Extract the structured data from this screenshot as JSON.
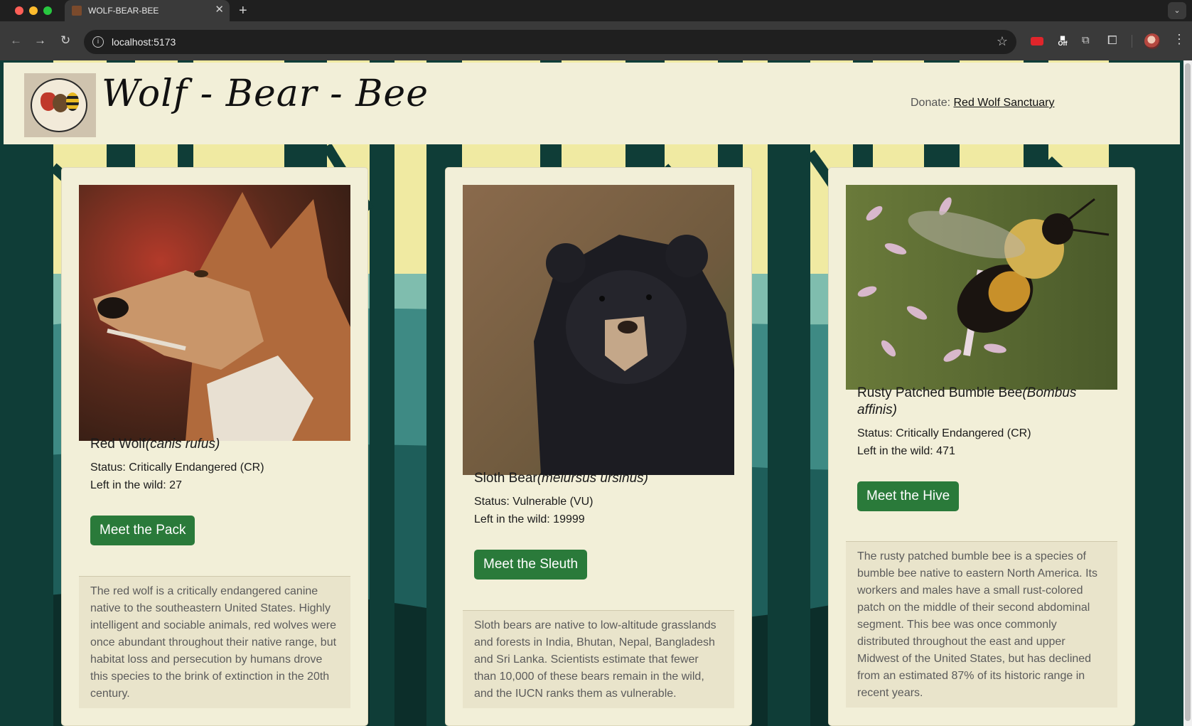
{
  "browser": {
    "tab_title": "WOLF-BEAR-BEE",
    "url": "localhost:5173",
    "extension_off_label": "Off"
  },
  "site": {
    "title": "Wolf - Bear - Bee",
    "donate_label": "Donate:",
    "donate_link": "Red Wolf Sanctuary"
  },
  "cards": [
    {
      "name": "Red Wolf",
      "latin": "(canis rufus)",
      "status": "Status: Critically Endangered (CR)",
      "wild": "Left in the wild: 27",
      "button": "Meet the Pack",
      "description": "The red wolf is a critically endangered canine native to the southeastern United States. Highly intelligent and sociable animals, red wolves were once abundant throughout their native range, but habitat loss and persecution by humans drove this species to the brink of extinction in the 20th century."
    },
    {
      "name": "Sloth Bear",
      "latin": "(melursus ursinus)",
      "status": "Status: Vulnerable (VU)",
      "wild": "Left in the wild: 19999",
      "button": "Meet the Sleuth",
      "description": "Sloth bears are native to low-altitude grasslands and forests in India, Bhutan, Nepal, Bangladesh and Sri Lanka. Scientists estimate that fewer than 10,000 of these bears remain in the wild, and the IUCN ranks them as vulnerable."
    },
    {
      "name": "Rusty Patched Bumble Bee",
      "latin": "(Bombus affinis)",
      "status": "Status: Critically Endangered (CR)",
      "wild": "Left in the wild: 471",
      "button": "Meet the Hive",
      "description": "The rusty patched bumble bee is a species of bumble bee native to eastern North America. Its workers and males have a small rust-colored patch on the middle of their second abdominal segment. This bee was once commonly distributed throughout the east and upper Midwest of the United States, but has declined from an estimated 87% of its historic range in recent years."
    }
  ],
  "colors": {
    "button": "#2a7a3a",
    "card_bg": "#f2efd8",
    "forest_dark": "#0e3b36",
    "sky": "#f0eaa2"
  }
}
